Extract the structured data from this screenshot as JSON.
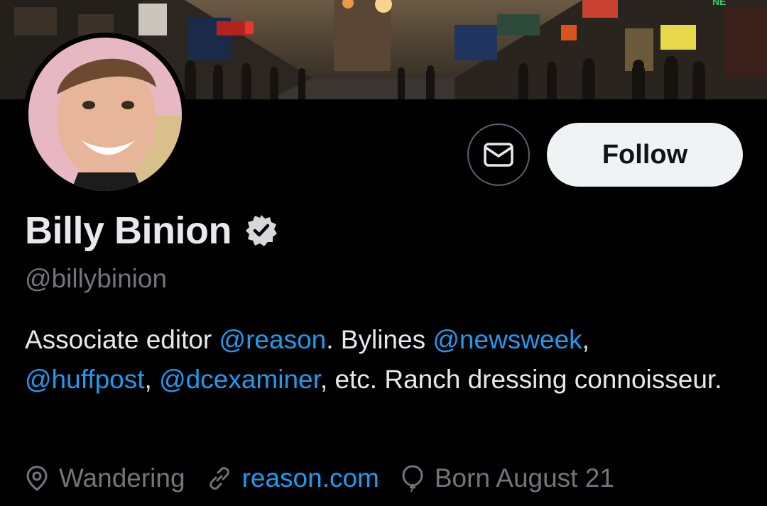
{
  "profile": {
    "display_name": "Billy Binion",
    "handle": "@billybinion",
    "verified": true
  },
  "actions": {
    "follow_label": "Follow"
  },
  "bio": {
    "part1": "Associate editor ",
    "mention_reason": "@reason",
    "part2": ". Bylines ",
    "mention_newsweek": "@newsweek",
    "part3": ",",
    "mention_huffpost": "@huffpost",
    "part4": ", ",
    "mention_dcexaminer": "@dcexaminer",
    "part5": ", etc. Ranch dressing connoisseur."
  },
  "meta": {
    "location": "Wandering",
    "website": "reason.com",
    "birthday": "Born August 21"
  },
  "banner": {
    "sign_text": "NE"
  },
  "icons": {
    "verified": "verified-badge-icon",
    "message": "envelope-icon",
    "location": "location-pin-icon",
    "link": "link-icon",
    "birthday": "balloon-icon"
  },
  "colors": {
    "background": "#000000",
    "text": "#e7e9ea",
    "secondary_text": "#71767b",
    "link": "#1d9bf0",
    "follow_button_bg": "#eff3f4"
  }
}
